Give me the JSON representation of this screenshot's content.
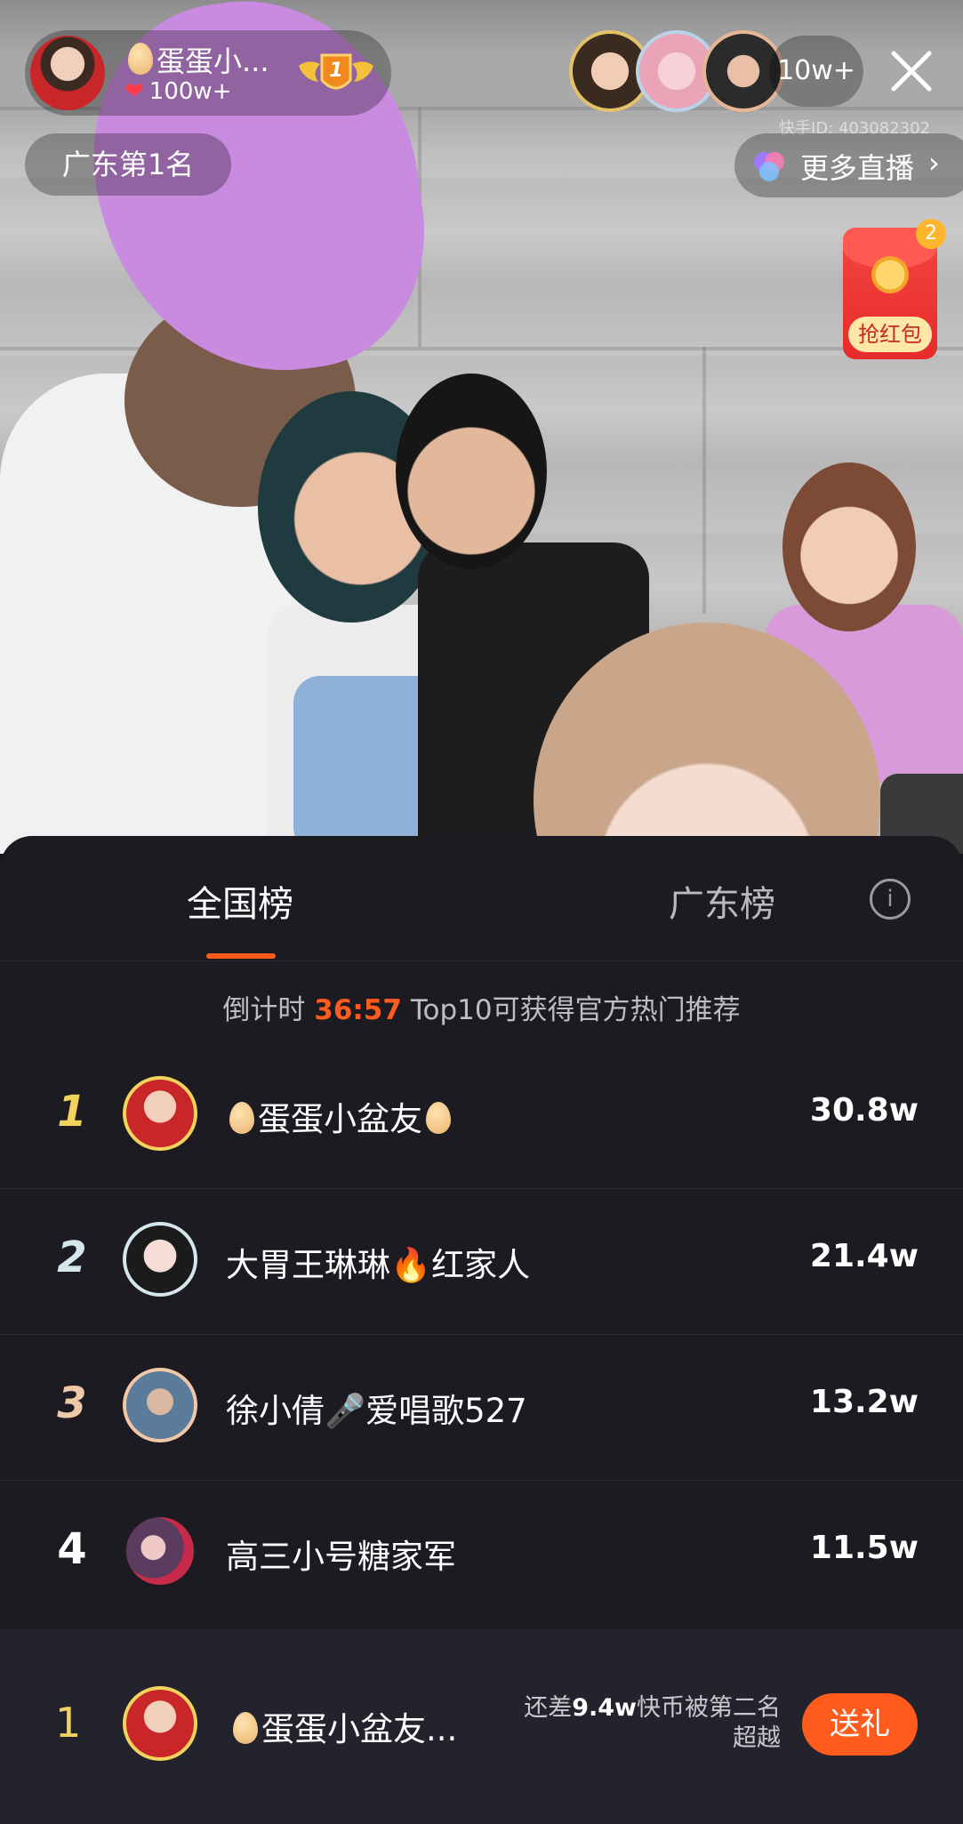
{
  "header": {
    "anchor_name": "蛋蛋小...",
    "anchor_likes": "100w+",
    "anchor_level": "1",
    "viewer_count": "10w+",
    "kuaishou_id": "快手ID: 403082302",
    "region_rank": "广东第1名",
    "more_live_label": "更多直播",
    "redpack_label": "抢红包",
    "redpack_count": "2"
  },
  "sheet": {
    "tabs": [
      {
        "label": "全国榜",
        "active": true
      },
      {
        "label": "广东榜",
        "active": false
      }
    ],
    "countdown_prefix": "倒计时",
    "countdown_time": "36:57",
    "countdown_suffix": "Top10可获得官方热门推荐",
    "rows": [
      {
        "rank": "1",
        "name": "蛋蛋小盆友",
        "score": "30.8w",
        "rank_color": "#f2d35c"
      },
      {
        "rank": "2",
        "name": "大胃王琳琳🔥红家人",
        "score": "21.4w",
        "rank_color": "#d6e6ef"
      },
      {
        "rank": "3",
        "name": "徐小倩🎤爱唱歌527",
        "score": "13.2w",
        "rank_color": "#efc8a8"
      },
      {
        "rank": "4",
        "name": "高三小号糖家军",
        "score": "11.5w",
        "rank_color": "#ffffff"
      }
    ],
    "self": {
      "rank": "1",
      "name": "蛋蛋小盆友...",
      "gap_prefix": "还差",
      "gap_value": "9.4w",
      "gap_suffix": "快币被第二名超越",
      "gift_label": "送礼"
    }
  }
}
